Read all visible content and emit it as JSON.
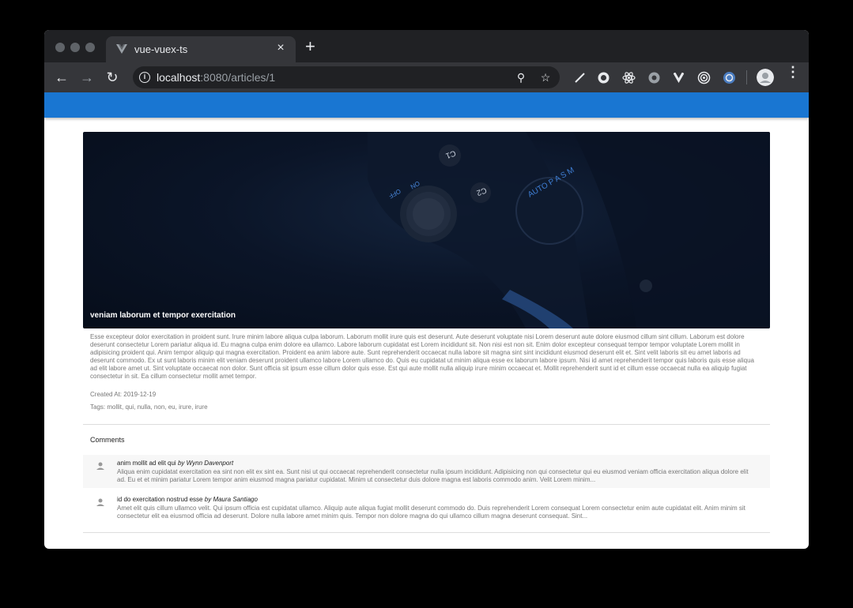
{
  "browser": {
    "tab_title": "vue-vuex-ts",
    "tab_close": "×",
    "new_tab": "+",
    "url_host": "localhost",
    "url_rest": ":8080/articles/1",
    "back": "←",
    "forward": "→",
    "reload": "↻",
    "menu": "⋮",
    "zoom": "⚲",
    "star": "☆"
  },
  "colors": {
    "app_bar": "#1976d2",
    "browser_frame": "#202124",
    "toolbar": "#35363a"
  },
  "article": {
    "hero_title": "veniam laborum et tempor exercitation",
    "body": "Esse excepteur dolor exercitation in proident sunt. Irure minim labore aliqua culpa laborum. Laborum mollit irure quis est deserunt. Aute deserunt voluptate nisi Lorem deserunt aute dolore eiusmod cillum sint cillum. Laborum est dolore deserunt consectetur Lorem pariatur aliqua id. Eu magna culpa enim dolore ea ullamco. Labore laborum cupidatat est Lorem incididunt sit. Non nisi est non sit. Enim dolor excepteur consequat tempor tempor voluptate Lorem mollit in adipisicing proident qui. Anim tempor aliquip qui magna exercitation. Proident ea anim labore aute. Sunt reprehenderit occaecat nulla labore sit magna sint sint incididunt eiusmod deserunt elit et. Sint velit laboris sit eu amet laboris ad deserunt commodo. Ex ut sunt laboris minim elit veniam deserunt proident ullamco labore Lorem ullamco do. Quis eu cupidatat ut minim aliqua esse ex laborum labore ipsum. Nisi id amet reprehenderit tempor quis laboris quis esse aliqua ad elit labore amet ut. Sint voluptate occaecat non dolor. Sunt officia sit ipsum esse cillum dolor quis esse. Est qui aute mollit nulla aliquip irure minim occaecat et. Mollit reprehenderit sunt id et cillum esse occaecat nulla ea aliquip fugiat consectetur in sit. Ea cillum consectetur mollit amet tempor.",
    "created_at": "Created At: 2019-12-19",
    "tags": "Tags: mollit, qui, nulla, non, eu, irure, irure"
  },
  "comments": {
    "title": "Comments",
    "items": [
      {
        "text": "anim mollit ad elit qui",
        "by": "by",
        "author": "Wynn Davenport",
        "body": "Aliqua enim cupidatat exercitation ea sint non elit ex sint ea. Sunt nisi ut qui occaecat reprehenderit consectetur nulla ipsum incididunt. Adipisicing non qui consectetur qui eu eiusmod veniam officia exercitation aliqua dolore elit ad. Eu et et minim pariatur Lorem tempor anim eiusmod magna pariatur cupidatat. Minim ut consectetur duis dolore magna est laboris commodo anim. Velit Lorem minim..."
      },
      {
        "text": "id do exercitation nostrud esse",
        "by": "by",
        "author": "Maura Santiago",
        "body": "Amet elit quis cillum ullamco velit. Qui ipsum officia est cupidatat ullamco. Aliquip aute aliqua fugiat mollit deserunt commodo do. Duis reprehenderit Lorem consequat Lorem consectetur enim aute cupidatat elit. Anim minim sit consectetur elit ea eiusmod officia ad deserunt. Dolore nulla labore amet minim quis. Tempor non dolore magna do qui ullamco cillum magna deserunt consequat. Sint..."
      }
    ]
  },
  "hero_dial": {
    "c1": "C1",
    "c2": "C2",
    "on": "ON",
    "off": "OFF",
    "modes": "AUTO P A S M"
  }
}
